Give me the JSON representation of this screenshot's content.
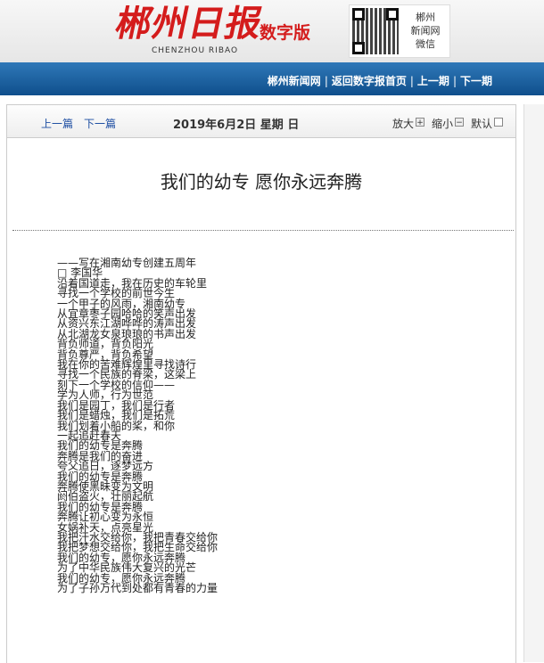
{
  "header": {
    "logo_text": "郴州日报",
    "digital_label": "数字版",
    "logo_en": "CHENZHOU RIBAO",
    "qr_caption": [
      "郴州",
      "新闻网",
      "微信"
    ]
  },
  "nav": {
    "links": [
      "郴州新闻网",
      "返回数字报首页",
      "上一期",
      "下一期"
    ]
  },
  "toolbar": {
    "prev_article": "上一篇",
    "next_article": "下一篇",
    "date": "2019年6月2日  星期 日",
    "zoom_in": "放大",
    "zoom_out": "缩小",
    "default": "默认"
  },
  "article": {
    "title": "我们的幼专  愿你永远奔腾",
    "lines": [
      "——写在湘南幼专创建五周年",
      "□ 李国华",
      "沿着国道走，我在历史的车轮里",
      "寻找一个学校的前世今生",
      "一个甲子的风雨，湘南幼专",
      "从宜章枣子园哈哈的笑声出发",
      "从资兴东江湖哗哗的涛声出发",
      "从北湖龙女泉琅琅的书声出发",
      "背负师道，背负阳光",
      "背负尊严，背负希望",
      "我在你的苦难辉煌里寻找诗行",
      "寻找一个民族的脊梁，这梁上",
      "刻下一个学校的信仰——",
      "学为人师，行为世范",
      "我们是园丁，我们是行者",
      "我们是蜡烛，我们是拓荒",
      "我们划着小船的桨，和你",
      "一起追赶春天",
      "我们的幼专是奔腾",
      "奔腾是我们的奋进",
      "夸父追日，逐梦远方",
      "我们的幼专是奔腾",
      "奔腾使黑昧变为文明",
      "阏伯盗火，壮丽起航",
      "我们的幼专是奔腾",
      "奔腾让初心变为永恒",
      "女娲补天，点亮星光",
      "我把汗水交给你，我把青春交给你",
      "我把梦想交给你，我把生命交给你",
      "我们的幼专，愿你永远奔腾",
      "为了中华民族伟大复兴的光芒",
      "我们的幼专，愿你永远奔腾",
      "为了子孙万代到处都有青春的力量"
    ]
  }
}
